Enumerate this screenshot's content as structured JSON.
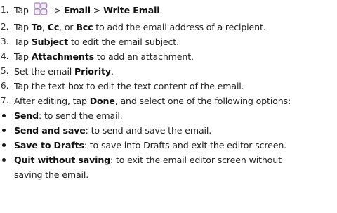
{
  "steps": [
    {
      "num": "1.",
      "parts": [
        {
          "text": "Tap ",
          "bold": false
        },
        {
          "icon": "apps-grid-icon"
        },
        {
          "text": " > ",
          "bold": false
        },
        {
          "text": "Email",
          "bold": true
        },
        {
          "text": " > ",
          "bold": false
        },
        {
          "text": "Write Email",
          "bold": true
        },
        {
          "text": ".",
          "bold": false
        }
      ]
    },
    {
      "num": "2.",
      "parts": [
        {
          "text": "Tap ",
          "bold": false
        },
        {
          "text": "To",
          "bold": true
        },
        {
          "text": ", ",
          "bold": false
        },
        {
          "text": "Cc",
          "bold": true
        },
        {
          "text": ", or ",
          "bold": false
        },
        {
          "text": "Bcc",
          "bold": true
        },
        {
          "text": " to add the email address of a recipient.",
          "bold": false
        }
      ]
    },
    {
      "num": "3.",
      "parts": [
        {
          "text": "Tap ",
          "bold": false
        },
        {
          "text": "Subject",
          "bold": true
        },
        {
          "text": " to edit the email subject.",
          "bold": false
        }
      ]
    },
    {
      "num": "4.",
      "parts": [
        {
          "text": "Tap ",
          "bold": false
        },
        {
          "text": "Attachments",
          "bold": true
        },
        {
          "text": " to add an attachment.",
          "bold": false
        }
      ]
    },
    {
      "num": "5.",
      "parts": [
        {
          "text": "Set the email ",
          "bold": false
        },
        {
          "text": "Priority",
          "bold": true
        },
        {
          "text": ".",
          "bold": false
        }
      ]
    },
    {
      "num": "6.",
      "parts": [
        {
          "text": "Tap the text box to edit the text content of the email.",
          "bold": false
        }
      ]
    },
    {
      "num": "7.",
      "parts": [
        {
          "text": "After editing, tap ",
          "bold": false
        },
        {
          "text": "Done",
          "bold": true
        },
        {
          "text": ", and select one of the following options:",
          "bold": false
        }
      ]
    }
  ],
  "options": [
    {
      "lines": [
        [
          {
            "text": "Send",
            "bold": true
          },
          {
            "text": ": to send the email.",
            "bold": false
          }
        ]
      ]
    },
    {
      "lines": [
        [
          {
            "text": "Send and save",
            "bold": true
          },
          {
            "text": ": to send and save the email.",
            "bold": false
          }
        ]
      ]
    },
    {
      "lines": [
        [
          {
            "text": "Save to Drafts",
            "bold": true
          },
          {
            "text": ": to save into Drafts and exit the editor screen.",
            "bold": false
          }
        ]
      ]
    },
    {
      "lines": [
        [
          {
            "text": "Quit without saving",
            "bold": true
          },
          {
            "text": ": to exit the email editor screen without",
            "bold": false
          }
        ],
        [
          {
            "text": "saving the email.",
            "bold": false
          }
        ]
      ]
    }
  ],
  "colors": {
    "icon_stroke": "#a98bb8",
    "icon_fill": "#f4eef7",
    "text": "#222222",
    "bold_text": "#111111"
  }
}
